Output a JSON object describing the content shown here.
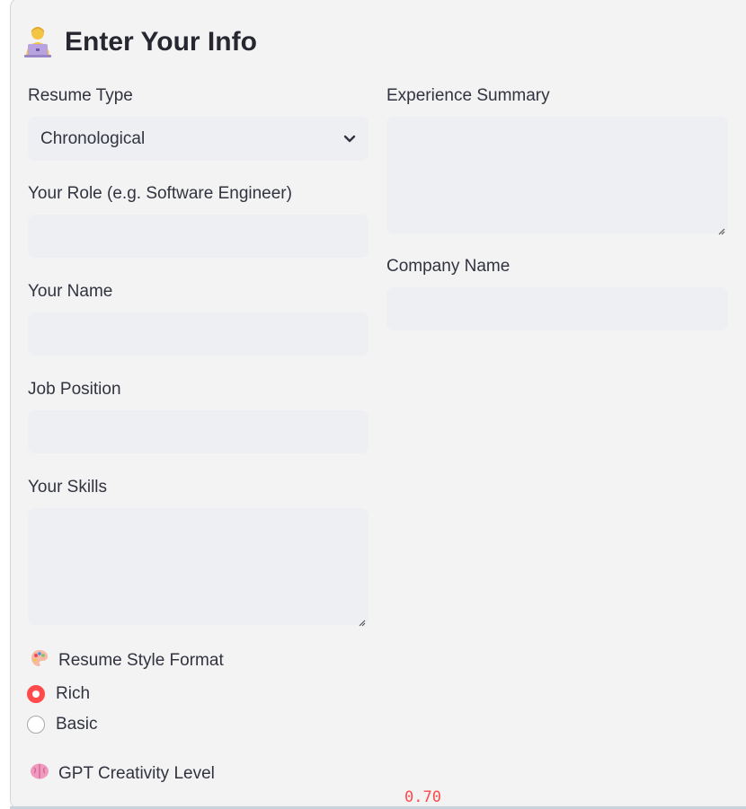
{
  "header": {
    "title": "Enter Your Info",
    "icon": "person-laptop-icon"
  },
  "left": {
    "resume_type": {
      "label": "Resume Type",
      "value": "Chronological"
    },
    "role": {
      "label": "Your Role (e.g. Software Engineer)",
      "value": ""
    },
    "name": {
      "label": "Your Name",
      "value": ""
    },
    "job_position": {
      "label": "Job Position",
      "value": ""
    },
    "skills": {
      "label": "Your Skills",
      "value": ""
    },
    "style_format": {
      "label": "Resume Style Format",
      "icon": "palette-icon",
      "options": [
        "Rich",
        "Basic"
      ],
      "selected": "Rich"
    },
    "creativity": {
      "label": "GPT Creativity Level",
      "icon": "brain-icon",
      "value": "0.70"
    }
  },
  "right": {
    "experience": {
      "label": "Experience Summary",
      "value": ""
    },
    "company": {
      "label": "Company Name",
      "value": ""
    }
  },
  "colors": {
    "accent": "#ff4b4b",
    "field_bg": "#eeeff3",
    "panel_bg": "#f3f3f4"
  }
}
